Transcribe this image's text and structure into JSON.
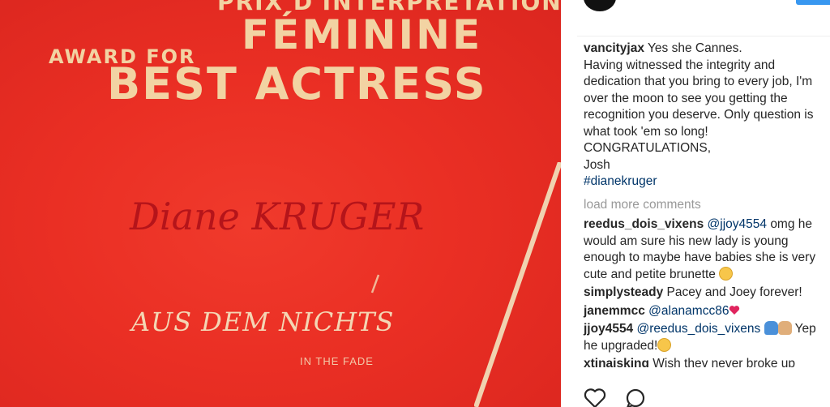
{
  "poster": {
    "prix": "PRIX D'INTERPRETATION",
    "feminine": "FÉMININE",
    "award_for": "AWARD FOR",
    "best_actress": "BEST ACTRESS",
    "actress": "Diane KRUGER",
    "film": "AUS DEM NICHTS",
    "film_english": "IN THE FADE"
  },
  "caption": {
    "user": "vancityjax",
    "lines": [
      "Yes she Cannes.",
      "Having witnessed the integrity and dedication that you bring to every job, I'm over the moon to see you getting the recognition you deserve. Only question is what took 'em so long!",
      "CONGRATULATIONS,",
      "Josh"
    ],
    "hashtag": "#dianekruger"
  },
  "load_more": "load more comments",
  "comments": [
    {
      "user": "reedus_dois_vixens",
      "mention": "@jjoy4554",
      "text": "omg he would am sure his new lady is young enough to maybe have babies she is very cute and petite brunette",
      "emoji": "smiling-face"
    },
    {
      "user": "simplysteady",
      "text": "Pacey and Joey forever!"
    },
    {
      "user": "janemmcc",
      "mention": "@alanamcc86",
      "emoji": "red-heart"
    },
    {
      "user": "jjoy4554",
      "mention": "@reedus_dois_vixens",
      "text_after": "Yep he upgraded!",
      "emoji_a": "person-emoji",
      "emoji_b": "hand-emoji",
      "emoji_c": "smiling-face"
    },
    {
      "user": "xtinaisking",
      "text": "Wish they never broke up"
    }
  ],
  "colors": {
    "poster_red": "#ea2f24",
    "poster_gold": "#f2d3a3",
    "name_red": "#b5141a",
    "link": "#003569",
    "muted": "#999999",
    "follow_blue": "#3897f0"
  },
  "icons": [
    "heart-icon",
    "comment-icon"
  ]
}
